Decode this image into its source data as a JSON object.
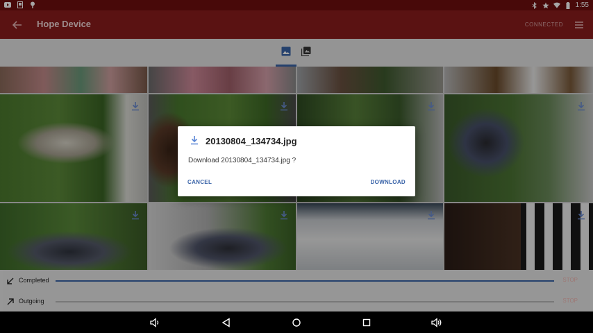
{
  "status_bar": {
    "time": "1:55",
    "left_icons": [
      "youtube-icon",
      "sim-icon",
      "location-icon"
    ],
    "right_icons": [
      "bluetooth-icon",
      "star-icon",
      "wifi-icon",
      "battery-icon"
    ]
  },
  "app_bar": {
    "title": "Hope Device",
    "connection_status": "CONNECTED"
  },
  "tabs": [
    {
      "icon": "photos-icon",
      "selected": true
    },
    {
      "icon": "albums-icon",
      "selected": false
    }
  ],
  "colors": {
    "status_bar": "#6f0f0f",
    "app_bar": "#8b1d1d",
    "accent": "#3a64a8",
    "stop_text": "#f3b7b2"
  },
  "transfers": [
    {
      "label": "Completed",
      "progress": 1.0,
      "stop_label": "STOP",
      "icon": "arrow-down-left-icon"
    },
    {
      "label": "Outgoing",
      "progress": 0.0,
      "stop_label": "STOP",
      "icon": "arrow-up-right-icon"
    }
  ],
  "dialog": {
    "title": "20130804_134734.jpg",
    "message": "Download 20130804_134734.jpg ?",
    "cancel_label": "CANCEL",
    "confirm_label": "DOWNLOAD"
  },
  "nav_bar": [
    "volume-down-icon",
    "back-icon",
    "home-icon",
    "recents-icon",
    "volume-up-icon"
  ]
}
